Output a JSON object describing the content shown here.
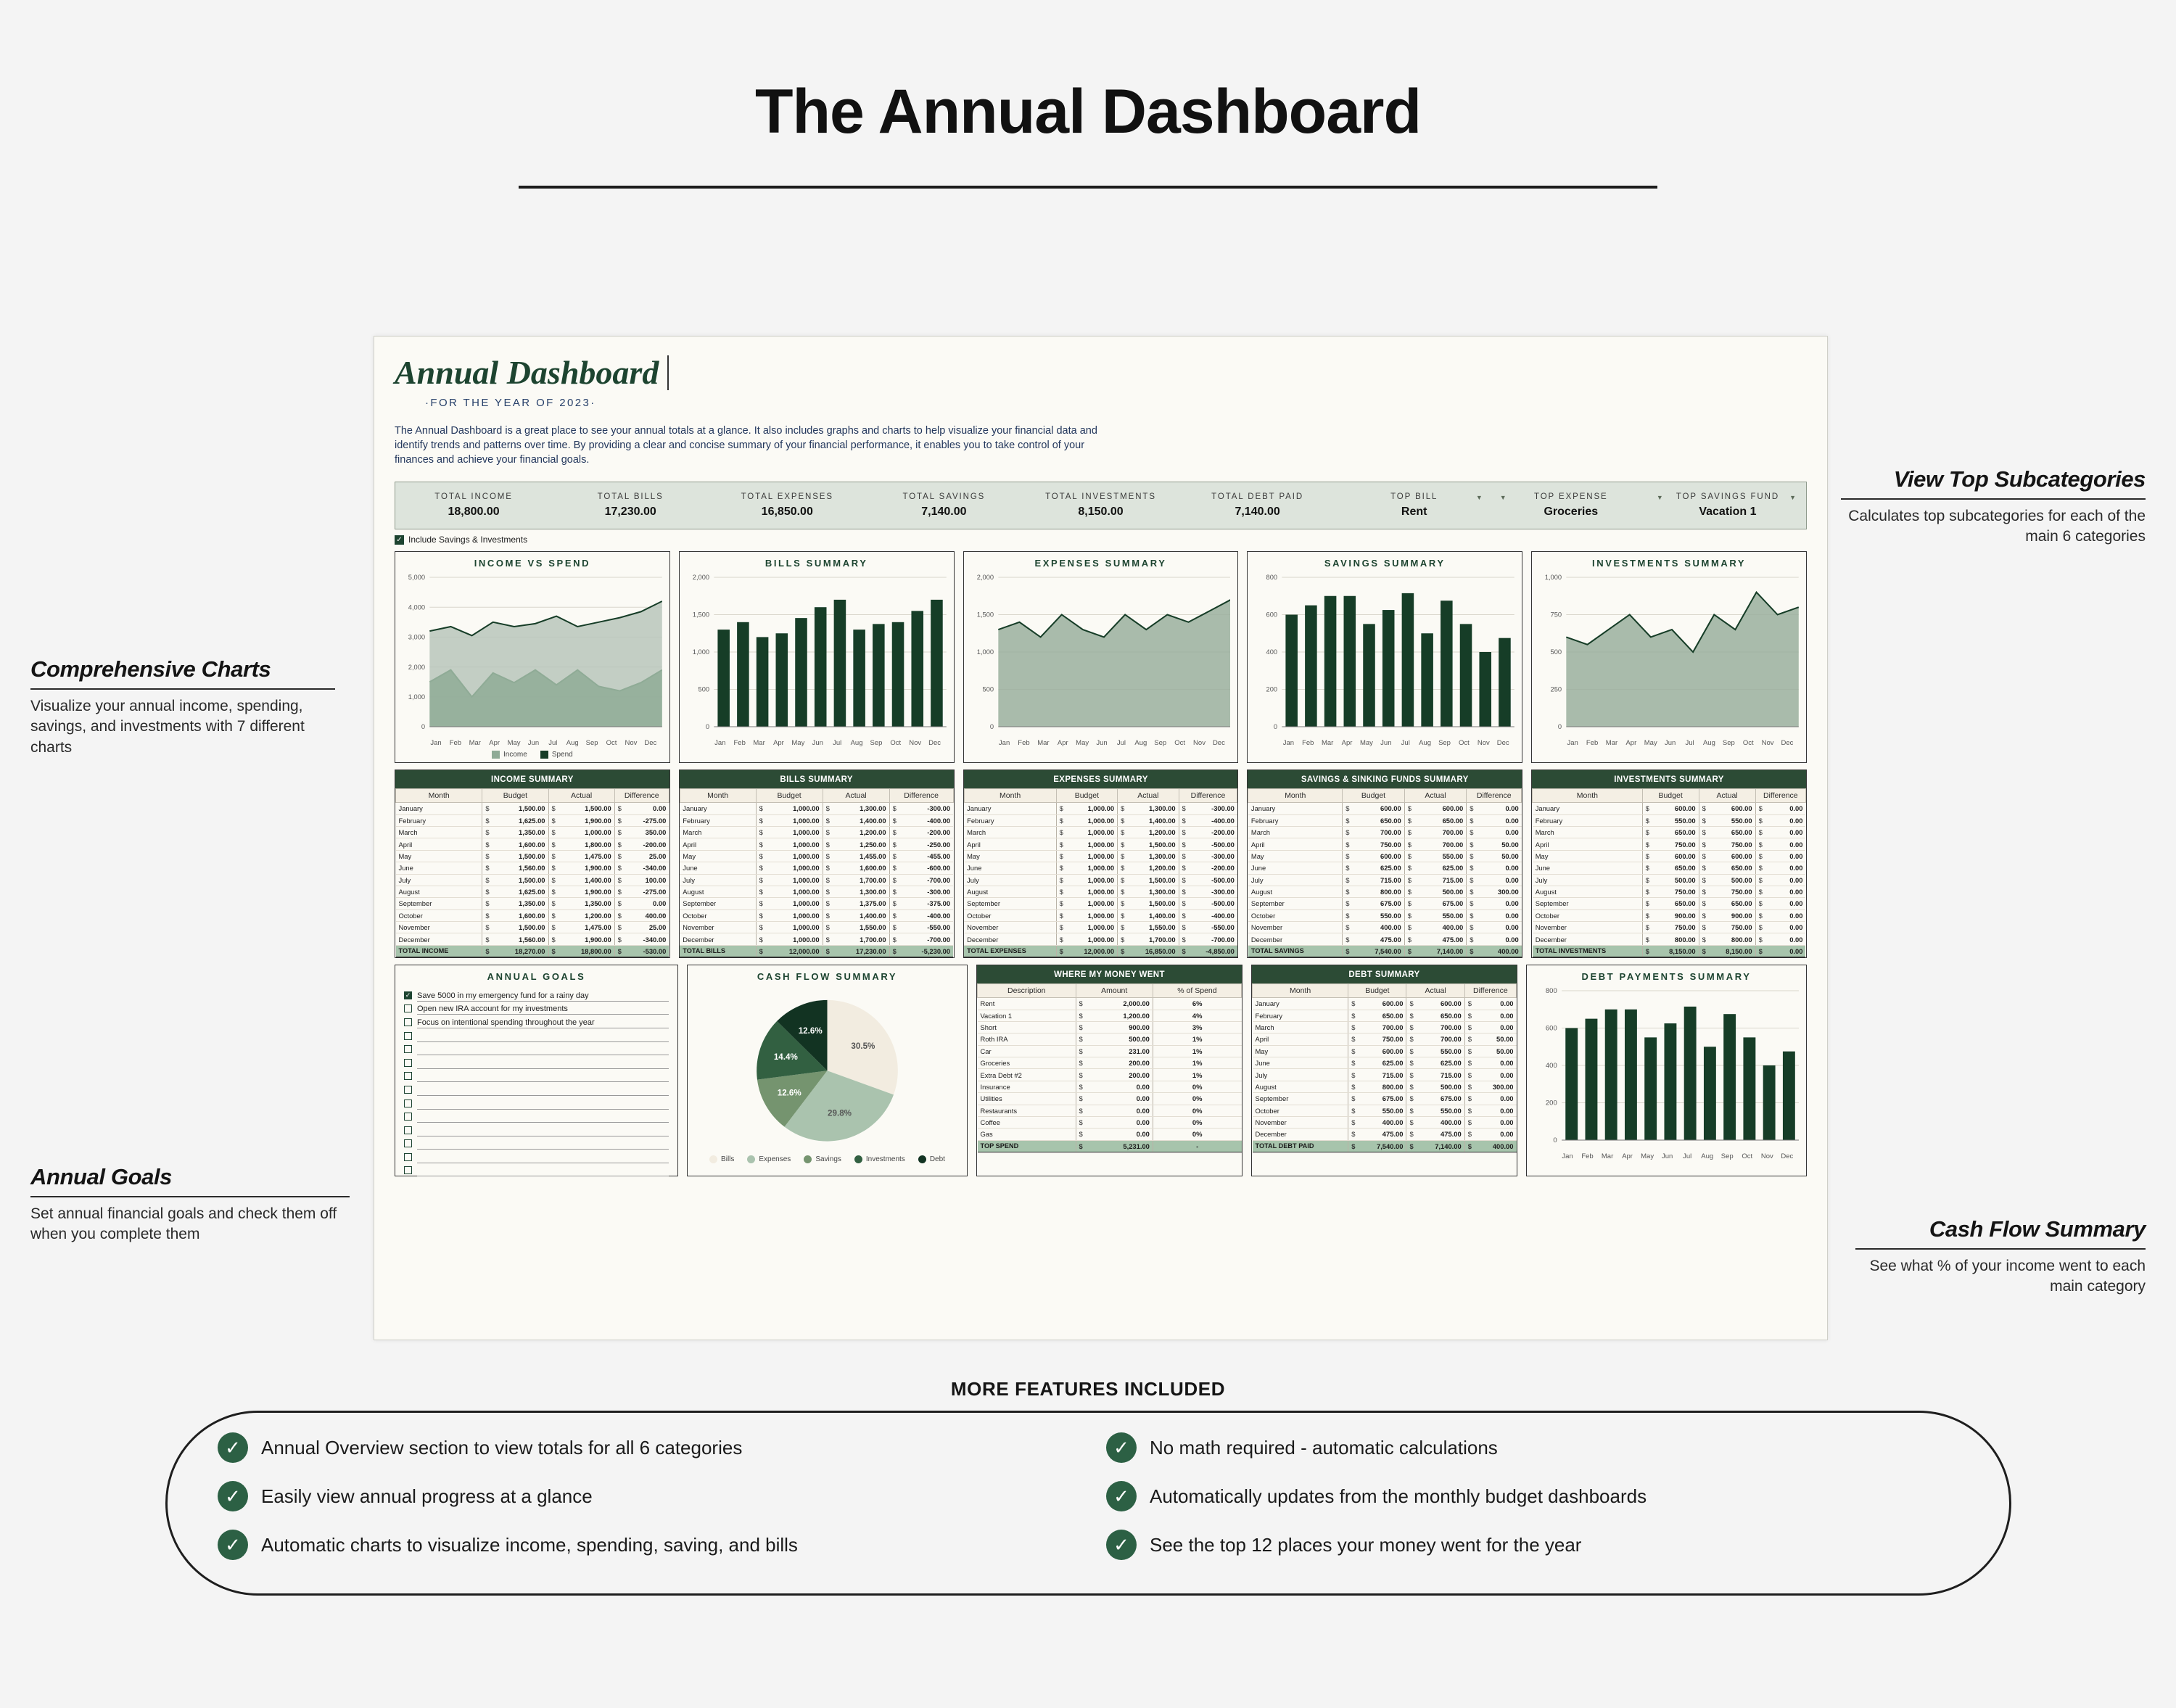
{
  "page": {
    "title": "The Annual Dashboard",
    "features_heading": "MORE FEATURES INCLUDED"
  },
  "sheet": {
    "title": "Annual Dashboard",
    "subtitle": "·FOR THE YEAR OF 2023·",
    "description": "The Annual Dashboard is a great place to see your annual totals at a glance. It also includes graphs and charts to help visualize your financial data and identify trends and patterns over time. By providing a clear and concise summary of your financial performance, it enables you to take control of your finances and achieve your financial goals.",
    "include_toggle_label": "Include Savings & Investments",
    "include_toggle_checked": true
  },
  "stats": [
    {
      "label": "TOTAL INCOME",
      "value": "18,800.00",
      "filter": null
    },
    {
      "label": "TOTAL BILLS",
      "value": "17,230.00",
      "filter": null
    },
    {
      "label": "TOTAL EXPENSES",
      "value": "16,850.00",
      "filter": null
    },
    {
      "label": "TOTAL SAVINGS",
      "value": "7,140.00",
      "filter": null
    },
    {
      "label": "TOTAL INVESTMENTS",
      "value": "8,150.00",
      "filter": null
    },
    {
      "label": "TOTAL DEBT PAID",
      "value": "7,140.00",
      "filter": null
    },
    {
      "label": "TOP BILL",
      "value": "Rent",
      "filter": "right"
    },
    {
      "label": "TOP EXPENSE",
      "value": "Groceries",
      "filter": "left"
    },
    {
      "label": "TOP SAVINGS FUND",
      "value": "Vacation 1",
      "filter": "both"
    }
  ],
  "months_short": [
    "Jan",
    "Feb",
    "Mar",
    "Apr",
    "May",
    "Jun",
    "Jul",
    "Aug",
    "Sep",
    "Oct",
    "Nov",
    "Dec"
  ],
  "months_long": [
    "January",
    "February",
    "March",
    "April",
    "May",
    "June",
    "July",
    "August",
    "September",
    "October",
    "November",
    "December"
  ],
  "table_headers": [
    "Month",
    "Budget",
    "Actual",
    "Difference"
  ],
  "chart_data": [
    {
      "type": "area",
      "title": "INCOME VS SPEND",
      "x": [
        "Jan",
        "Feb",
        "Mar",
        "Apr",
        "May",
        "Jun",
        "Jul",
        "Aug",
        "Sep",
        "Oct",
        "Nov",
        "Dec"
      ],
      "ylim": [
        0,
        5000
      ],
      "yticks": [
        0,
        1000,
        2000,
        3000,
        4000,
        5000
      ],
      "yticklabels": [
        "0",
        "1,000",
        "2,000",
        "3,000",
        "4,000",
        "5,000"
      ],
      "grid": true,
      "legend": [
        "Income",
        "Spend"
      ],
      "legend_position": "bottom",
      "series": [
        {
          "name": "Income",
          "values": [
            1500,
            1900,
            1000,
            1800,
            1475,
            1900,
            1400,
            1900,
            1350,
            1200,
            1475,
            1900
          ],
          "color": "#8fab96"
        },
        {
          "name": "Spend",
          "values": [
            3200,
            3350,
            3050,
            3500,
            3350,
            3450,
            3700,
            3350,
            3500,
            3650,
            3850,
            4200
          ],
          "color": "#163d27"
        }
      ]
    },
    {
      "type": "bar",
      "title": "BILLS SUMMARY",
      "categories": [
        "Jan",
        "Feb",
        "Mar",
        "Apr",
        "May",
        "Jun",
        "Jul",
        "Aug",
        "Sep",
        "Oct",
        "Nov",
        "Dec"
      ],
      "values": [
        1300,
        1400,
        1200,
        1250,
        1455,
        1600,
        1700,
        1300,
        1375,
        1400,
        1550,
        1700
      ],
      "ylim": [
        0,
        2000
      ],
      "yticks": [
        0,
        500,
        1000,
        1500,
        2000
      ],
      "yticklabels": [
        "0",
        "500",
        "1,000",
        "1,500",
        "2,000"
      ],
      "grid": true,
      "color": "#163d27"
    },
    {
      "type": "area",
      "title": "EXPENSES SUMMARY",
      "x": [
        "Jan",
        "Feb",
        "Mar",
        "Apr",
        "May",
        "Jun",
        "Jul",
        "Aug",
        "Sep",
        "Oct",
        "Nov",
        "Dec"
      ],
      "values": [
        1300,
        1400,
        1200,
        1500,
        1300,
        1200,
        1500,
        1300,
        1500,
        1400,
        1550,
        1700
      ],
      "ylim": [
        0,
        2000
      ],
      "yticks": [
        0,
        500,
        1000,
        1500,
        2000
      ],
      "yticklabels": [
        "0",
        "500",
        "1,000",
        "1,500",
        "2,000"
      ],
      "grid": true,
      "color": "#163d27",
      "fill": "#9aaf9e"
    },
    {
      "type": "bar",
      "title": "SAVINGS SUMMARY",
      "categories": [
        "Jan",
        "Feb",
        "Mar",
        "Apr",
        "May",
        "Jun",
        "Jul",
        "Aug",
        "Sep",
        "Oct",
        "Nov",
        "Dec"
      ],
      "values": [
        600,
        650,
        700,
        700,
        550,
        625,
        715,
        500,
        675,
        550,
        400,
        475
      ],
      "ylim": [
        0,
        800
      ],
      "yticks": [
        0,
        200,
        400,
        600,
        800
      ],
      "yticklabels": [
        "0",
        "200",
        "400",
        "600",
        "800"
      ],
      "grid": true,
      "color": "#163d27"
    },
    {
      "type": "area",
      "title": "INVESTMENTS SUMMARY",
      "x": [
        "Jan",
        "Feb",
        "Mar",
        "Apr",
        "May",
        "Jun",
        "Jul",
        "Aug",
        "Sep",
        "Oct",
        "Nov",
        "Dec"
      ],
      "values": [
        600,
        550,
        650,
        750,
        600,
        650,
        500,
        750,
        650,
        900,
        750,
        800
      ],
      "ylim": [
        0,
        1000
      ],
      "yticks": [
        0,
        250,
        500,
        750,
        1000
      ],
      "yticklabels": [
        "0",
        "250",
        "500",
        "750",
        "1,000"
      ],
      "grid": true,
      "color": "#163d27",
      "fill": "#9aaf9e"
    },
    {
      "type": "pie",
      "title": "CASH FLOW SUMMARY",
      "labels": [
        "Bills",
        "Expenses",
        "Savings",
        "Investments",
        "Debt"
      ],
      "values": [
        30.5,
        29.8,
        12.6,
        14.4,
        12.6
      ],
      "display_labels": [
        "30.5%",
        "29.8%",
        "12.6%",
        "14.4%",
        "12.6%"
      ],
      "colors": [
        "#f2ece0",
        "#aac3ae",
        "#75946f",
        "#326041",
        "#123322"
      ],
      "legend_position": "bottom"
    },
    {
      "type": "bar",
      "title": "DEBT PAYMENTS SUMMARY",
      "categories": [
        "Jan",
        "Feb",
        "Mar",
        "Apr",
        "May",
        "Jun",
        "Jul",
        "Aug",
        "Sep",
        "Oct",
        "Nov",
        "Dec"
      ],
      "values": [
        600,
        650,
        700,
        700,
        550,
        625,
        715,
        500,
        675,
        550,
        400,
        475
      ],
      "ylim": [
        0,
        800
      ],
      "yticks": [
        0,
        200,
        400,
        600,
        800
      ],
      "yticklabels": [
        "0",
        "200",
        "400",
        "600",
        "800"
      ],
      "grid": true,
      "color": "#163d27"
    }
  ],
  "tables": {
    "income": {
      "title": "INCOME SUMMARY",
      "total_label": "TOTAL INCOME",
      "rows": [
        [
          "January",
          "1,500.00",
          "1,500.00",
          "0.00"
        ],
        [
          "February",
          "1,625.00",
          "1,900.00",
          "-275.00"
        ],
        [
          "March",
          "1,350.00",
          "1,000.00",
          "350.00"
        ],
        [
          "April",
          "1,600.00",
          "1,800.00",
          "-200.00"
        ],
        [
          "May",
          "1,500.00",
          "1,475.00",
          "25.00"
        ],
        [
          "June",
          "1,560.00",
          "1,900.00",
          "-340.00"
        ],
        [
          "July",
          "1,500.00",
          "1,400.00",
          "100.00"
        ],
        [
          "August",
          "1,625.00",
          "1,900.00",
          "-275.00"
        ],
        [
          "September",
          "1,350.00",
          "1,350.00",
          "0.00"
        ],
        [
          "October",
          "1,600.00",
          "1,200.00",
          "400.00"
        ],
        [
          "November",
          "1,500.00",
          "1,475.00",
          "25.00"
        ],
        [
          "December",
          "1,560.00",
          "1,900.00",
          "-340.00"
        ]
      ],
      "total": [
        "18,270.00",
        "18,800.00",
        "-530.00"
      ]
    },
    "bills": {
      "title": "BILLS SUMMARY",
      "total_label": "TOTAL BILLS",
      "rows": [
        [
          "January",
          "1,000.00",
          "1,300.00",
          "-300.00"
        ],
        [
          "February",
          "1,000.00",
          "1,400.00",
          "-400.00"
        ],
        [
          "March",
          "1,000.00",
          "1,200.00",
          "-200.00"
        ],
        [
          "April",
          "1,000.00",
          "1,250.00",
          "-250.00"
        ],
        [
          "May",
          "1,000.00",
          "1,455.00",
          "-455.00"
        ],
        [
          "June",
          "1,000.00",
          "1,600.00",
          "-600.00"
        ],
        [
          "July",
          "1,000.00",
          "1,700.00",
          "-700.00"
        ],
        [
          "August",
          "1,000.00",
          "1,300.00",
          "-300.00"
        ],
        [
          "September",
          "1,000.00",
          "1,375.00",
          "-375.00"
        ],
        [
          "October",
          "1,000.00",
          "1,400.00",
          "-400.00"
        ],
        [
          "November",
          "1,000.00",
          "1,550.00",
          "-550.00"
        ],
        [
          "December",
          "1,000.00",
          "1,700.00",
          "-700.00"
        ]
      ],
      "total": [
        "12,000.00",
        "17,230.00",
        "-5,230.00"
      ]
    },
    "expenses": {
      "title": "EXPENSES SUMMARY",
      "total_label": "TOTAL EXPENSES",
      "rows": [
        [
          "January",
          "1,000.00",
          "1,300.00",
          "-300.00"
        ],
        [
          "February",
          "1,000.00",
          "1,400.00",
          "-400.00"
        ],
        [
          "March",
          "1,000.00",
          "1,200.00",
          "-200.00"
        ],
        [
          "April",
          "1,000.00",
          "1,500.00",
          "-500.00"
        ],
        [
          "May",
          "1,000.00",
          "1,300.00",
          "-300.00"
        ],
        [
          "June",
          "1,000.00",
          "1,200.00",
          "-200.00"
        ],
        [
          "July",
          "1,000.00",
          "1,500.00",
          "-500.00"
        ],
        [
          "August",
          "1,000.00",
          "1,300.00",
          "-300.00"
        ],
        [
          "September",
          "1,000.00",
          "1,500.00",
          "-500.00"
        ],
        [
          "October",
          "1,000.00",
          "1,400.00",
          "-400.00"
        ],
        [
          "November",
          "1,000.00",
          "1,550.00",
          "-550.00"
        ],
        [
          "December",
          "1,000.00",
          "1,700.00",
          "-700.00"
        ]
      ],
      "total": [
        "12,000.00",
        "16,850.00",
        "-4,850.00"
      ]
    },
    "savings": {
      "title": "SAVINGS & SINKING FUNDS SUMMARY",
      "total_label": "TOTAL SAVINGS",
      "rows": [
        [
          "January",
          "600.00",
          "600.00",
          "0.00"
        ],
        [
          "February",
          "650.00",
          "650.00",
          "0.00"
        ],
        [
          "March",
          "700.00",
          "700.00",
          "0.00"
        ],
        [
          "April",
          "750.00",
          "700.00",
          "50.00"
        ],
        [
          "May",
          "600.00",
          "550.00",
          "50.00"
        ],
        [
          "June",
          "625.00",
          "625.00",
          "0.00"
        ],
        [
          "July",
          "715.00",
          "715.00",
          "0.00"
        ],
        [
          "August",
          "800.00",
          "500.00",
          "300.00"
        ],
        [
          "September",
          "675.00",
          "675.00",
          "0.00"
        ],
        [
          "October",
          "550.00",
          "550.00",
          "0.00"
        ],
        [
          "November",
          "400.00",
          "400.00",
          "0.00"
        ],
        [
          "December",
          "475.00",
          "475.00",
          "0.00"
        ]
      ],
      "total": [
        "7,540.00",
        "7,140.00",
        "400.00"
      ]
    },
    "investments": {
      "title": "INVESTMENTS SUMMARY",
      "total_label": "TOTAL INVESTMENTS",
      "rows": [
        [
          "January",
          "600.00",
          "600.00",
          "0.00"
        ],
        [
          "February",
          "550.00",
          "550.00",
          "0.00"
        ],
        [
          "March",
          "650.00",
          "650.00",
          "0.00"
        ],
        [
          "April",
          "750.00",
          "750.00",
          "0.00"
        ],
        [
          "May",
          "600.00",
          "600.00",
          "0.00"
        ],
        [
          "June",
          "650.00",
          "650.00",
          "0.00"
        ],
        [
          "July",
          "500.00",
          "500.00",
          "0.00"
        ],
        [
          "August",
          "750.00",
          "750.00",
          "0.00"
        ],
        [
          "September",
          "650.00",
          "650.00",
          "0.00"
        ],
        [
          "October",
          "900.00",
          "900.00",
          "0.00"
        ],
        [
          "November",
          "750.00",
          "750.00",
          "0.00"
        ],
        [
          "December",
          "800.00",
          "800.00",
          "0.00"
        ]
      ],
      "total": [
        "8,150.00",
        "8,150.00",
        "0.00"
      ]
    },
    "debt": {
      "title": "DEBT SUMMARY",
      "total_label": "TOTAL DEBT PAID",
      "rows": [
        [
          "January",
          "600.00",
          "600.00",
          "0.00"
        ],
        [
          "February",
          "650.00",
          "650.00",
          "0.00"
        ],
        [
          "March",
          "700.00",
          "700.00",
          "0.00"
        ],
        [
          "April",
          "750.00",
          "700.00",
          "50.00"
        ],
        [
          "May",
          "600.00",
          "550.00",
          "50.00"
        ],
        [
          "June",
          "625.00",
          "625.00",
          "0.00"
        ],
        [
          "July",
          "715.00",
          "715.00",
          "0.00"
        ],
        [
          "August",
          "800.00",
          "500.00",
          "300.00"
        ],
        [
          "September",
          "675.00",
          "675.00",
          "0.00"
        ],
        [
          "October",
          "550.00",
          "550.00",
          "0.00"
        ],
        [
          "November",
          "400.00",
          "400.00",
          "0.00"
        ],
        [
          "December",
          "475.00",
          "475.00",
          "0.00"
        ]
      ],
      "total": [
        "7,540.00",
        "7,140.00",
        "400.00"
      ]
    },
    "money_went": {
      "title": "WHERE MY MONEY WENT",
      "headers": [
        "Description",
        "Amount",
        "% of Spend"
      ],
      "total_label": "TOP SPEND",
      "rows": [
        [
          "Rent",
          "2,000.00",
          "6%"
        ],
        [
          "Vacation 1",
          "1,200.00",
          "4%"
        ],
        [
          "Short",
          "900.00",
          "3%"
        ],
        [
          "Roth IRA",
          "500.00",
          "1%"
        ],
        [
          "Car",
          "231.00",
          "1%"
        ],
        [
          "Groceries",
          "200.00",
          "1%"
        ],
        [
          "Extra Debt #2",
          "200.00",
          "1%"
        ],
        [
          "Insurance",
          "0.00",
          "0%"
        ],
        [
          "Utilities",
          "0.00",
          "0%"
        ],
        [
          "Restaurants",
          "0.00",
          "0%"
        ],
        [
          "Coffee",
          "0.00",
          "0%"
        ],
        [
          "Gas",
          "0.00",
          "0%"
        ]
      ],
      "total": [
        "5,231.00",
        "-"
      ]
    }
  },
  "goals": {
    "title": "ANNUAL GOALS",
    "items": [
      {
        "text": "Save 5000 in my emergency fund for a rainy day",
        "checked": true
      },
      {
        "text": "Open new IRA account for my investments",
        "checked": false
      },
      {
        "text": "Focus on intentional spending throughout the year",
        "checked": false
      },
      {
        "text": "",
        "checked": false
      },
      {
        "text": "",
        "checked": false
      },
      {
        "text": "",
        "checked": false
      },
      {
        "text": "",
        "checked": false
      },
      {
        "text": "",
        "checked": false
      },
      {
        "text": "",
        "checked": false
      },
      {
        "text": "",
        "checked": false
      },
      {
        "text": "",
        "checked": false
      },
      {
        "text": "",
        "checked": false
      },
      {
        "text": "",
        "checked": false
      },
      {
        "text": "",
        "checked": false
      }
    ]
  },
  "annotations": {
    "charts": {
      "heading": "Comprehensive Charts",
      "body": "Visualize your annual income, spending, savings, and investments with 7 different charts"
    },
    "goals": {
      "heading": "Annual Goals",
      "body": "Set annual financial goals and check them off when you complete them"
    },
    "top_subcategories": {
      "heading": "View Top Subcategories",
      "body": "Calculates top subcategories for each of the main 6 categories"
    },
    "cash_flow": {
      "heading": "Cash Flow Summary",
      "body": "See what % of your income went to each main category"
    }
  },
  "features": [
    "Annual Overview section to view totals for all 6 categories",
    "No math required - automatic calculations",
    "Easily view annual progress at a glance",
    "Automatically updates from the monthly budget dashboards",
    "Automatic charts to visualize income, spending, saving, and bills",
    "See the top 12 places your money went for the year"
  ],
  "colors": {
    "dark_green": "#1d4430",
    "header_green": "#2c4b35",
    "chart_dark": "#163d27",
    "total_row": "#a7c4ac",
    "stats_bg": "#dde4dc",
    "sheet_bg": "#fbfaf5"
  }
}
